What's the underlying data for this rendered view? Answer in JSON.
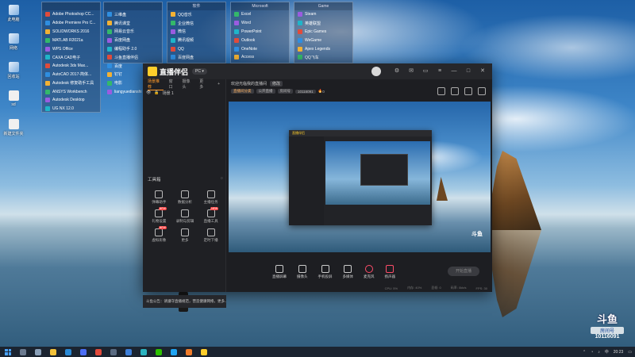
{
  "desktop": {
    "icons": [
      {
        "label": "此电脑"
      },
      {
        "label": "网络"
      },
      {
        "label": "回收站"
      },
      {
        "label": "sd"
      },
      {
        "label": "新建文件夹"
      }
    ],
    "fences": [
      {
        "title": "",
        "items": [
          "Adobe Photoshop CC...",
          "Adobe Premiere Pro C...",
          "SOLIDWORKS 2016",
          "MATLAB R2021a",
          "WPS Office",
          "CAXA CAD电子",
          "Autodesk 3ds Max...",
          "AutoCAD 2017-简体...",
          "Autodesk 修复助手工具",
          "ANSYS Workbench",
          "Autodesk Desktop",
          "UG NX 12.0"
        ]
      },
      {
        "title": "",
        "items": [
          "三维盘",
          "腾讯课堂",
          "网易云音乐",
          "百度网盘",
          "编程助手 2.0",
          "斗鱼直播伴侣",
          "百度",
          "钉钉",
          "电影",
          "liangyuedianshi"
        ]
      },
      {
        "title": "软件",
        "items": [
          "QQ音乐",
          "企业微信",
          "微信",
          "腾讯视频",
          "QQ",
          "百度网盘",
          "腾讯会议"
        ]
      },
      {
        "title": "Microsoft",
        "items": [
          "Excel",
          "Word",
          "PowerPoint",
          "Outlook",
          "OneNote",
          "Access",
          "Publisher"
        ]
      },
      {
        "title": "Game",
        "items": [
          "Steam",
          "英雄联盟",
          "Epic Games",
          "WeGame",
          "Apex Legends",
          "QQ飞车"
        ]
      }
    ]
  },
  "app": {
    "title": "直播伴侣",
    "mode_badge": "PC ▾",
    "left_tabs": [
      "场景推荐",
      "窗口",
      "摄像头",
      "更多"
    ],
    "scene_label": "场景 1",
    "tools_title": "工具箱",
    "tools": [
      {
        "label": "弹幕助手",
        "is_new": false
      },
      {
        "label": "数据分析",
        "is_new": false
      },
      {
        "label": "主播任务",
        "is_new": false
      },
      {
        "label": "礼物设置",
        "is_new": true
      },
      {
        "label": "录制与剪辑",
        "is_new": false
      },
      {
        "label": "直播工具",
        "is_new": true
      },
      {
        "label": "虚拟形象",
        "is_new": true
      },
      {
        "label": "更多",
        "is_new": false
      },
      {
        "label": "定时下播",
        "is_new": false
      }
    ],
    "notice": "斗鱼公告：请遵守直播规范，营造健康网络，更多...",
    "room_title": "欢迎光临我的直播间",
    "edit_label": "修改",
    "chips": [
      "直播间分类",
      "公开直播",
      "房间号",
      "10116091"
    ],
    "popularity": "0",
    "controls": [
      {
        "label": "直播屏幕",
        "icon": "screen-icon"
      },
      {
        "label": "摄像头",
        "icon": "camera-icon"
      },
      {
        "label": "手机投屏",
        "icon": "phone-icon"
      },
      {
        "label": "多媒体",
        "icon": "media-icon"
      },
      {
        "label": "麦克风",
        "icon": "mic-icon"
      },
      {
        "label": "扬声器",
        "icon": "speaker-icon"
      }
    ],
    "go_live": "开始直播",
    "status": [
      "CPU: 5%",
      "内存: 40%",
      "丢帧: 0",
      "码率: 0kb/s",
      "FPS: 30"
    ],
    "watermark": "斗鱼"
  },
  "corner": {
    "logo": "斗鱼",
    "room_label": "房间号",
    "room_number": "10116091"
  },
  "taskbar": {
    "time": "20:23",
    "lang": "中"
  },
  "colors": {
    "accent": "#ff9a2b",
    "brand_yellow": "#ffce2b",
    "live_red": "#ff4d6a"
  }
}
